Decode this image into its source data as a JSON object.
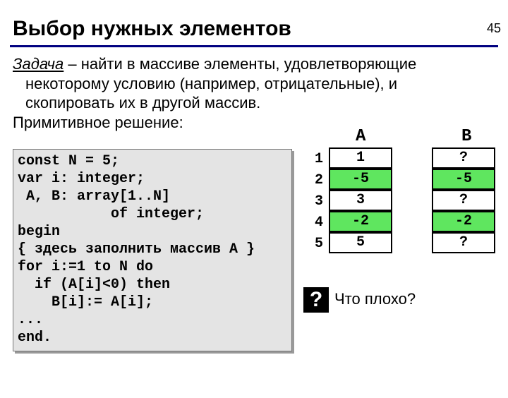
{
  "page_number": "45",
  "title": "Выбор нужных элементов",
  "task_label": "Задача",
  "task_text_1": " – найти в массиве элементы, удовлетворяющие",
  "task_text_2": "некоторому условию (например, отрицательные), и",
  "task_text_3": "скопировать их в другой массив.",
  "primitive_label": "Примитивное решение:",
  "code": "const N = 5;\nvar i: integer;\n A, B: array[1..N]\n           of integer;\nbegin\n{ здесь заполнить массив A }\nfor i:=1 to N do\n  if (A[i]<0) then\n    B[i]:= A[i];\n...\nend.",
  "col_a": "A",
  "col_b": "B",
  "rows": {
    "1": {
      "idx": "1",
      "a": "1",
      "b": "?"
    },
    "2": {
      "idx": "2",
      "a": "-5",
      "b": "-5"
    },
    "3": {
      "idx": "3",
      "a": "3",
      "b": "?"
    },
    "4": {
      "idx": "4",
      "a": "-2",
      "b": "-2"
    },
    "5": {
      "idx": "5",
      "a": "5",
      "b": "?"
    }
  },
  "question_mark": "?",
  "question_text": "Что плохо?"
}
